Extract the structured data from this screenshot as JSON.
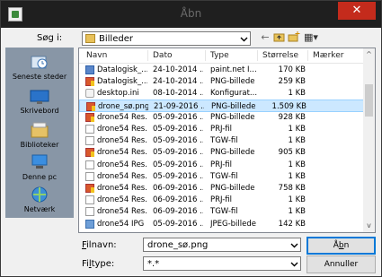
{
  "window": {
    "title": "Åbn",
    "close_glyph": "✕"
  },
  "lookin": {
    "label": "Søg i:",
    "value": "Billeder"
  },
  "toolbar": {
    "back": "←",
    "up": "⮌",
    "newfolder": "✱",
    "views": "▦▾"
  },
  "places": [
    {
      "label": "Seneste steder",
      "icon": "recent-places-icon"
    },
    {
      "label": "Skrivebord",
      "icon": "desktop-icon"
    },
    {
      "label": "Biblioteker",
      "icon": "libraries-icon"
    },
    {
      "label": "Denne pc",
      "icon": "this-pc-icon"
    },
    {
      "label": "Netværk",
      "icon": "network-icon"
    }
  ],
  "columns": {
    "name": "Navn",
    "date": "Dato",
    "type": "Type",
    "size": "Størrelse",
    "tags": "Mærker"
  },
  "files": [
    {
      "icon": "pdn",
      "name": "Datalogisk_...",
      "date": "24-10-2014 ...",
      "type": "paint.net I...",
      "size": "170 KB"
    },
    {
      "icon": "png",
      "name": "Datalogisk_...",
      "date": "24-10-2014 ...",
      "type": "PNG-billede",
      "size": "259 KB"
    },
    {
      "icon": "ini",
      "name": "desktop.ini",
      "date": "08-10-2014 ...",
      "type": "Konfigurat...",
      "size": "1 KB"
    },
    {
      "icon": "png",
      "name": "drone_sø.png",
      "date": "21-09-2016 ...",
      "type": "PNG-billede",
      "size": "1.509 KB",
      "selected": true
    },
    {
      "icon": "png",
      "name": "drone54 Res...",
      "date": "05-09-2016 ...",
      "type": "PNG-billede",
      "size": "928 KB"
    },
    {
      "icon": "doc",
      "name": "drone54 Res...",
      "date": "05-09-2016 ...",
      "type": "PRJ-fil",
      "size": "1 KB"
    },
    {
      "icon": "doc",
      "name": "drone54 Res...",
      "date": "05-09-2016 ...",
      "type": "TGW-fil",
      "size": "1 KB"
    },
    {
      "icon": "png",
      "name": "drone54 Res...",
      "date": "05-09-2016 ...",
      "type": "PNG-billede",
      "size": "905 KB"
    },
    {
      "icon": "doc",
      "name": "drone54 Res...",
      "date": "05-09-2016 ...",
      "type": "PRJ-fil",
      "size": "1 KB"
    },
    {
      "icon": "doc",
      "name": "drone54 Res...",
      "date": "05-09-2016 ...",
      "type": "TGW-fil",
      "size": "1 KB"
    },
    {
      "icon": "png",
      "name": "drone54 Res...",
      "date": "06-09-2016 ...",
      "type": "PNG-billede",
      "size": "758 KB"
    },
    {
      "icon": "doc",
      "name": "drone54 Res...",
      "date": "06-09-2016 ...",
      "type": "PRJ-fil",
      "size": "1 KB"
    },
    {
      "icon": "doc",
      "name": "drone54 Res...",
      "date": "06-09-2016 ...",
      "type": "TGW-fil",
      "size": "1 KB"
    },
    {
      "icon": "jpg",
      "name": "drone54 IPG",
      "date": "05-09-2016 ...",
      "type": "JPEG-billede",
      "size": "142 KB"
    }
  ],
  "filename": {
    "label_accel": "F",
    "label_rest": "ilnavn:",
    "value": "drone_sø.png"
  },
  "filetype": {
    "label_pre": "Fi",
    "label_accel": "l",
    "label_rest": "type:",
    "value": "*.*"
  },
  "buttons": {
    "open_pre": "Å",
    "open_accel": "b",
    "open_rest": "n",
    "cancel": "Annuller"
  }
}
